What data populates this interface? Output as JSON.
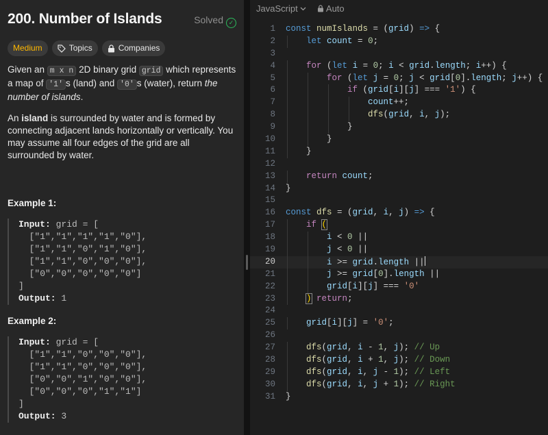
{
  "problem": {
    "title": "200. Number of Islands",
    "status": "Solved",
    "tags": {
      "difficulty": "Medium",
      "topics": "Topics",
      "companies": "Companies"
    },
    "desc1": {
      "a": "Given an ",
      "m_x_n": "m x n",
      "b": " 2D binary grid ",
      "grid": "grid",
      "c": " which represents a map of ",
      "one": "'1'",
      "d": "s (land) and ",
      "zero": "'0'",
      "e": "s (water), return ",
      "em": "the number of islands",
      "f": "."
    },
    "desc2": {
      "a": "An ",
      "island": "island",
      "b": " is surrounded by water and is formed by connecting adjacent lands horizontally or vertically. You may assume all four edges of the grid are all surrounded by water."
    },
    "examples": [
      {
        "title": "Example 1:",
        "input_label": "Input:",
        "input_head": " grid = [",
        "rows": [
          "  [\"1\",\"1\",\"1\",\"1\",\"0\"],",
          "  [\"1\",\"1\",\"0\",\"1\",\"0\"],",
          "  [\"1\",\"1\",\"0\",\"0\",\"0\"],",
          "  [\"0\",\"0\",\"0\",\"0\",\"0\"]"
        ],
        "close": "]",
        "output_label": "Output:",
        "output_value": " 1"
      },
      {
        "title": "Example 2:",
        "input_label": "Input:",
        "input_head": " grid = [",
        "rows": [
          "  [\"1\",\"1\",\"0\",\"0\",\"0\"],",
          "  [\"1\",\"1\",\"0\",\"0\",\"0\"],",
          "  [\"0\",\"0\",\"1\",\"0\",\"0\"],",
          "  [\"0\",\"0\",\"0\",\"1\",\"1\"]"
        ],
        "close": "]",
        "output_label": "Output:",
        "output_value": " 3"
      }
    ]
  },
  "editor": {
    "language": "JavaScript",
    "mode": "Auto",
    "active_line": 20,
    "lines": [
      [
        [
          "k",
          "const "
        ],
        [
          "f",
          "numIslands"
        ],
        [
          "p",
          " = ("
        ],
        [
          "v",
          "grid"
        ],
        [
          "p",
          ") "
        ],
        [
          "k",
          "=>"
        ],
        [
          "p",
          " {"
        ]
      ],
      [
        [
          "p",
          "    "
        ],
        [
          "k",
          "let "
        ],
        [
          "v",
          "count"
        ],
        [
          "p",
          " = "
        ],
        [
          "n",
          "0"
        ],
        [
          "p",
          ";"
        ]
      ],
      [],
      [
        [
          "p",
          "    "
        ],
        [
          "kf",
          "for"
        ],
        [
          "p",
          " ("
        ],
        [
          "k",
          "let "
        ],
        [
          "v",
          "i"
        ],
        [
          "p",
          " = "
        ],
        [
          "n",
          "0"
        ],
        [
          "p",
          "; "
        ],
        [
          "v",
          "i"
        ],
        [
          "p",
          " < "
        ],
        [
          "v",
          "grid"
        ],
        [
          "p",
          "."
        ],
        [
          "v",
          "length"
        ],
        [
          "p",
          "; "
        ],
        [
          "v",
          "i"
        ],
        [
          "p",
          "++) {"
        ]
      ],
      [
        [
          "p",
          "        "
        ],
        [
          "kf",
          "for"
        ],
        [
          "p",
          " ("
        ],
        [
          "k",
          "let "
        ],
        [
          "v",
          "j"
        ],
        [
          "p",
          " = "
        ],
        [
          "n",
          "0"
        ],
        [
          "p",
          "; "
        ],
        [
          "v",
          "j"
        ],
        [
          "p",
          " < "
        ],
        [
          "v",
          "grid"
        ],
        [
          "p",
          "["
        ],
        [
          "n",
          "0"
        ],
        [
          "p",
          "]."
        ],
        [
          "v",
          "length"
        ],
        [
          "p",
          "; "
        ],
        [
          "v",
          "j"
        ],
        [
          "p",
          "++) {"
        ]
      ],
      [
        [
          "p",
          "            "
        ],
        [
          "kf",
          "if"
        ],
        [
          "p",
          " ("
        ],
        [
          "v",
          "grid"
        ],
        [
          "p",
          "["
        ],
        [
          "v",
          "i"
        ],
        [
          "p",
          "]["
        ],
        [
          "v",
          "j"
        ],
        [
          "p",
          "] === "
        ],
        [
          "s",
          "'1'"
        ],
        [
          "p",
          ") {"
        ]
      ],
      [
        [
          "p",
          "                "
        ],
        [
          "v",
          "count"
        ],
        [
          "p",
          "++;"
        ]
      ],
      [
        [
          "p",
          "                "
        ],
        [
          "f",
          "dfs"
        ],
        [
          "p",
          "("
        ],
        [
          "v",
          "grid"
        ],
        [
          "p",
          ", "
        ],
        [
          "v",
          "i"
        ],
        [
          "p",
          ", "
        ],
        [
          "v",
          "j"
        ],
        [
          "p",
          ");"
        ]
      ],
      [
        [
          "p",
          "            }"
        ]
      ],
      [
        [
          "p",
          "        }"
        ]
      ],
      [
        [
          "p",
          "    }"
        ]
      ],
      [],
      [
        [
          "p",
          "    "
        ],
        [
          "kf",
          "return "
        ],
        [
          "v",
          "count"
        ],
        [
          "p",
          ";"
        ]
      ],
      [
        [
          "p",
          "}"
        ]
      ],
      [],
      [
        [
          "k",
          "const "
        ],
        [
          "f",
          "dfs"
        ],
        [
          "p",
          " = ("
        ],
        [
          "v",
          "grid"
        ],
        [
          "p",
          ", "
        ],
        [
          "v",
          "i"
        ],
        [
          "p",
          ", "
        ],
        [
          "v",
          "j"
        ],
        [
          "p",
          ") "
        ],
        [
          "k",
          "=>"
        ],
        [
          "p",
          " {"
        ]
      ],
      [
        [
          "p",
          "    "
        ],
        [
          "kf",
          "if "
        ],
        [
          "brb",
          "("
        ]
      ],
      [
        [
          "p",
          "        "
        ],
        [
          "v",
          "i"
        ],
        [
          "p",
          " < "
        ],
        [
          "n",
          "0"
        ],
        [
          "p",
          " ||"
        ]
      ],
      [
        [
          "p",
          "        "
        ],
        [
          "v",
          "j"
        ],
        [
          "p",
          " < "
        ],
        [
          "n",
          "0"
        ],
        [
          "p",
          " ||"
        ]
      ],
      [
        [
          "p",
          "        "
        ],
        [
          "v",
          "i"
        ],
        [
          "p",
          " >= "
        ],
        [
          "v",
          "grid"
        ],
        [
          "p",
          "."
        ],
        [
          "v",
          "length"
        ],
        [
          "p",
          " ||"
        ],
        [
          "cur",
          ""
        ]
      ],
      [
        [
          "p",
          "        "
        ],
        [
          "v",
          "j"
        ],
        [
          "p",
          " >= "
        ],
        [
          "v",
          "grid"
        ],
        [
          "p",
          "["
        ],
        [
          "n",
          "0"
        ],
        [
          "p",
          "]."
        ],
        [
          "v",
          "length"
        ],
        [
          "p",
          " ||"
        ]
      ],
      [
        [
          "p",
          "        "
        ],
        [
          "v",
          "grid"
        ],
        [
          "p",
          "["
        ],
        [
          "v",
          "i"
        ],
        [
          "p",
          "]["
        ],
        [
          "v",
          "j"
        ],
        [
          "p",
          "] === "
        ],
        [
          "s",
          "'0'"
        ]
      ],
      [
        [
          "p",
          "    "
        ],
        [
          "brb",
          ")"
        ],
        [
          "p",
          " "
        ],
        [
          "kf",
          "return"
        ],
        [
          "p",
          ";"
        ]
      ],
      [],
      [
        [
          "p",
          "    "
        ],
        [
          "v",
          "grid"
        ],
        [
          "p",
          "["
        ],
        [
          "v",
          "i"
        ],
        [
          "p",
          "]["
        ],
        [
          "v",
          "j"
        ],
        [
          "p",
          "] = "
        ],
        [
          "s",
          "'0'"
        ],
        [
          "p",
          ";"
        ]
      ],
      [],
      [
        [
          "p",
          "    "
        ],
        [
          "f",
          "dfs"
        ],
        [
          "p",
          "("
        ],
        [
          "v",
          "grid"
        ],
        [
          "p",
          ", "
        ],
        [
          "v",
          "i"
        ],
        [
          "p",
          " - "
        ],
        [
          "n",
          "1"
        ],
        [
          "p",
          ", "
        ],
        [
          "v",
          "j"
        ],
        [
          "p",
          "); "
        ],
        [
          "c",
          "// Up"
        ]
      ],
      [
        [
          "p",
          "    "
        ],
        [
          "f",
          "dfs"
        ],
        [
          "p",
          "("
        ],
        [
          "v",
          "grid"
        ],
        [
          "p",
          ", "
        ],
        [
          "v",
          "i"
        ],
        [
          "p",
          " + "
        ],
        [
          "n",
          "1"
        ],
        [
          "p",
          ", "
        ],
        [
          "v",
          "j"
        ],
        [
          "p",
          "); "
        ],
        [
          "c",
          "// Down"
        ]
      ],
      [
        [
          "p",
          "    "
        ],
        [
          "f",
          "dfs"
        ],
        [
          "p",
          "("
        ],
        [
          "v",
          "grid"
        ],
        [
          "p",
          ", "
        ],
        [
          "v",
          "i"
        ],
        [
          "p",
          ", "
        ],
        [
          "v",
          "j"
        ],
        [
          "p",
          " - "
        ],
        [
          "n",
          "1"
        ],
        [
          "p",
          "); "
        ],
        [
          "c",
          "// Left"
        ]
      ],
      [
        [
          "p",
          "    "
        ],
        [
          "f",
          "dfs"
        ],
        [
          "p",
          "("
        ],
        [
          "v",
          "grid"
        ],
        [
          "p",
          ", "
        ],
        [
          "v",
          "i"
        ],
        [
          "p",
          ", "
        ],
        [
          "v",
          "j"
        ],
        [
          "p",
          " + "
        ],
        [
          "n",
          "1"
        ],
        [
          "p",
          "); "
        ],
        [
          "c",
          "// Right"
        ]
      ],
      [
        [
          "p",
          "}"
        ]
      ]
    ]
  }
}
